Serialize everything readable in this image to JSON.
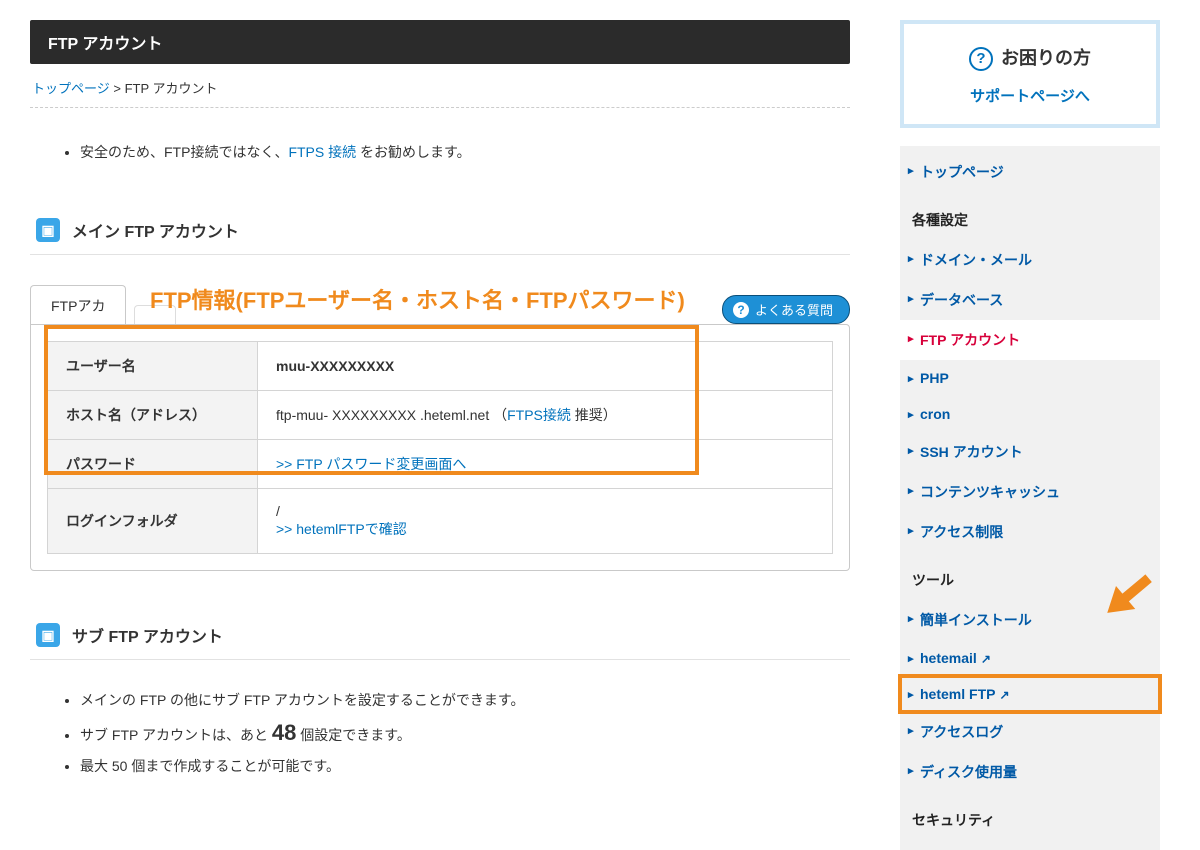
{
  "page_title": "FTP アカウント",
  "breadcrumbs": {
    "home": "トップページ",
    "sep": ">",
    "current": "FTP アカウント"
  },
  "notice": {
    "prefix": "安全のため、FTP接続ではなく、",
    "link": "FTPS 接続",
    "suffix": " をお勧めします。"
  },
  "main_section": {
    "title": "メイン FTP アカウント"
  },
  "tabs": {
    "tab1": "FTPアカ",
    "ghost": " ",
    "faq_button": "よくある質問"
  },
  "callout": "FTP情報(FTPユーザー名・ホスト名・FTPパスワード)",
  "table": {
    "user_label": "ユーザー名",
    "user_value": "muu-XXXXXXXXX",
    "host_label": "ホスト名（アドレス）",
    "host_value_pre": "ftp-muu- XXXXXXXXX .heteml.net （",
    "host_value_link": "FTPS接続",
    "host_value_post": " 推奨）",
    "pass_label": "パスワード",
    "pass_link": ">> FTP パスワード変更画面へ",
    "folder_label": "ログインフォルダ",
    "folder_slash": "/",
    "folder_link": ">> hetemlFTPで確認"
  },
  "sub_section": {
    "title": "サブ FTP アカウント",
    "line1": "メインの FTP の他にサブ FTP アカウントを設定することができます。",
    "line2_pre": "サブ FTP アカウントは、あと ",
    "line2_num": "48",
    "line2_post": " 個設定できます。",
    "line3": "最大 50 個まで作成することが可能です。"
  },
  "sidebar": {
    "help_title": "お困りの方",
    "help_link": "サポートページへ",
    "items": [
      {
        "label": "トップページ"
      }
    ],
    "group1_title": "各種設定",
    "group1": [
      {
        "label": "ドメイン・メール"
      },
      {
        "label": "データベース"
      },
      {
        "label": "FTP アカウント",
        "active": true
      },
      {
        "label": "PHP"
      },
      {
        "label": "cron"
      },
      {
        "label": "SSH アカウント"
      },
      {
        "label": "コンテンツキャッシュ"
      },
      {
        "label": "アクセス制限"
      }
    ],
    "group2_title": "ツール",
    "group2": [
      {
        "label": "簡単インストール"
      },
      {
        "label": "hetemail",
        "ext": true
      },
      {
        "label": "heteml FTP",
        "ext": true,
        "highlight": true
      },
      {
        "label": "アクセスログ"
      },
      {
        "label": "ディスク使用量"
      }
    ],
    "group3_title": "セキュリティ"
  }
}
